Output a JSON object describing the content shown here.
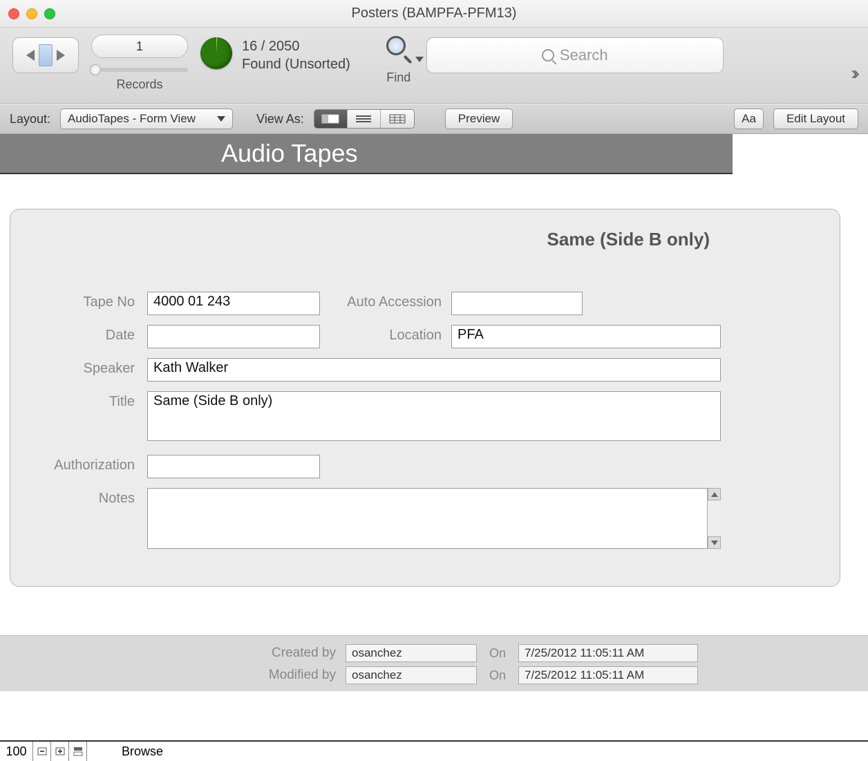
{
  "window": {
    "title": "Posters (BAMPFA-PFM13)"
  },
  "toolbar": {
    "record_number": "1",
    "records_label": "Records",
    "found_count": "16 / 2050",
    "found_status": "Found (Unsorted)",
    "find_label": "Find",
    "search_placeholder": "Search"
  },
  "layoutbar": {
    "layout_label": "Layout:",
    "layout_value": "AudioTapes - Form View",
    "view_as_label": "View As:",
    "preview_label": "Preview",
    "aa_label": "Aa",
    "edit_layout_label": "Edit Layout"
  },
  "header": {
    "title": "Audio Tapes"
  },
  "panel": {
    "heading": "Same (Side B only)",
    "labels": {
      "tape_no": "Tape No",
      "auto_accession": "Auto Accession",
      "date": "Date",
      "location": "Location",
      "speaker": "Speaker",
      "title": "Title",
      "authorization": "Authorization",
      "notes": "Notes"
    },
    "fields": {
      "tape_no": "4000 01 243",
      "auto_accession": "",
      "date": "",
      "location": "PFA",
      "speaker": "Kath Walker",
      "title": "Same (Side B only)",
      "authorization": "",
      "notes": ""
    }
  },
  "meta": {
    "created_by_label": "Created by",
    "modified_by_label": "Modified by",
    "on_label": "On",
    "created_by": "osanchez",
    "created_on": "7/25/2012 11:05:11 AM",
    "modified_by": "osanchez",
    "modified_on": "7/25/2012 11:05:11 AM"
  },
  "statusbar": {
    "zoom": "100",
    "mode": "Browse"
  }
}
